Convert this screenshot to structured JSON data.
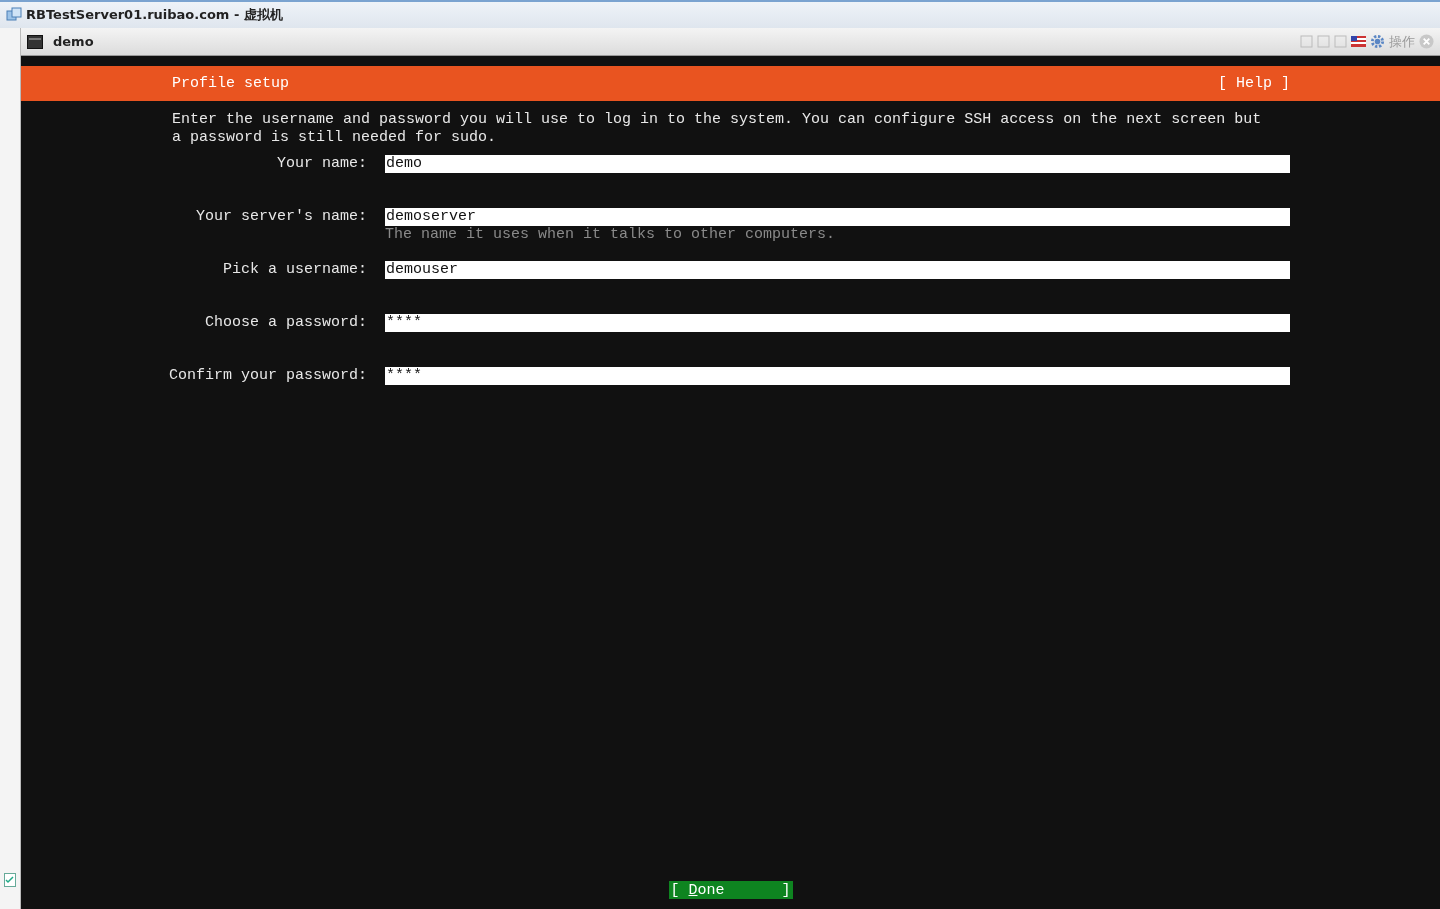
{
  "browser_window": {
    "title": "RBTestServer01.ruibao.com - 虚拟机"
  },
  "console_window": {
    "title": "demo",
    "toolbar": {
      "actions_label": "操作"
    }
  },
  "screen": {
    "header": {
      "title": "Profile setup",
      "help": "[ Help ]"
    },
    "intro": "Enter the username and password you will use to log in to the system. You can configure SSH access on the next screen but a password is still needed for sudo.",
    "fields": [
      {
        "label": "Your name:",
        "value": "demo"
      },
      {
        "label": "Your server's name:",
        "value": "demoserver",
        "hint": "The name it uses when it talks to other computers."
      },
      {
        "label": "Pick a username:",
        "value": "demouser"
      },
      {
        "label": "Choose a password:",
        "value": "****"
      },
      {
        "label": "Confirm your password:",
        "value": "****"
      }
    ],
    "done_button": {
      "open": "[",
      "label": "Done",
      "close": "]"
    }
  }
}
